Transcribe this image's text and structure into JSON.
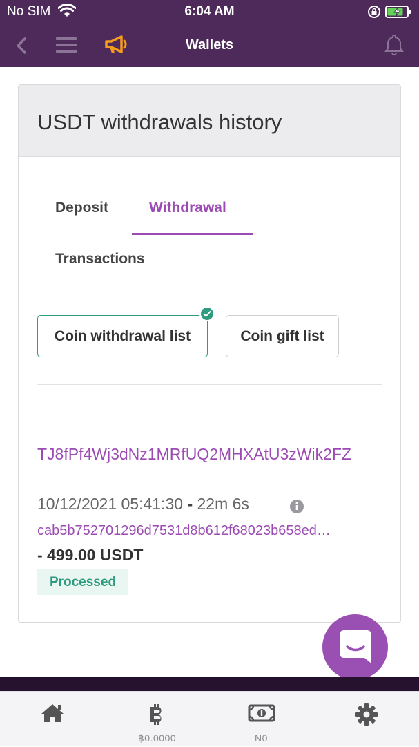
{
  "status_bar": {
    "carrier": "No SIM",
    "time": "6:04 AM"
  },
  "nav": {
    "title": "Wallets"
  },
  "card": {
    "title": "USDT withdrawals history"
  },
  "tabs": [
    {
      "label": "Deposit",
      "active": false
    },
    {
      "label": "Withdrawal",
      "active": true
    },
    {
      "label": "Transactions",
      "active": false
    }
  ],
  "filters": [
    {
      "label": "Coin withdrawal list",
      "selected": true
    },
    {
      "label": "Coin gift list",
      "selected": false
    }
  ],
  "withdrawal": {
    "address": "TJ8fPf4Wj3dNz1MRfUQ2MHXAtU3zWik2FZ",
    "datetime": "10/12/2021 05:41:30",
    "separator": "-",
    "elapsed": "22m 6s",
    "tx_hash": "cab5b752701296d7531d8b612f68023b658ed…",
    "amount": "- 499.00 USDT",
    "status": "Processed"
  },
  "tab_bar": {
    "items": [
      {
        "icon": "home-icon",
        "label": ""
      },
      {
        "icon": "bitcoin-icon",
        "label": "฿0.0000"
      },
      {
        "icon": "banknote-icon",
        "label": "₦0"
      },
      {
        "icon": "gear-icon",
        "label": ""
      }
    ]
  },
  "colors": {
    "header_bg": "#4d2a5a",
    "accent_purple": "#9b4bb3",
    "accent_green": "#2f9b7e",
    "megaphone": "#f39c1f"
  }
}
